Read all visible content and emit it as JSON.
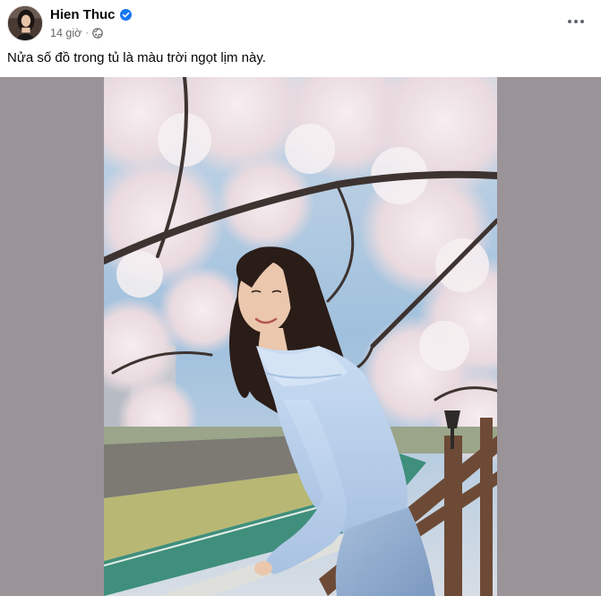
{
  "author": {
    "name": "Hien Thuc",
    "verified_icon": "verified-badge-icon"
  },
  "meta": {
    "time": "14 giờ",
    "separator": "·",
    "audience_icon": "globe-icon"
  },
  "menu_icon": "more-horizontal-icon",
  "caption": "Nửa số đồ trong tủ là màu trời ngọt lịm này.",
  "colors": {
    "verified": "#1877f2",
    "secondary_text": "#65676b",
    "media_background": "#9a9397"
  },
  "photo": {
    "subject": "woman in light blue sweater under cherry blossoms",
    "alt_icon": "photo"
  }
}
